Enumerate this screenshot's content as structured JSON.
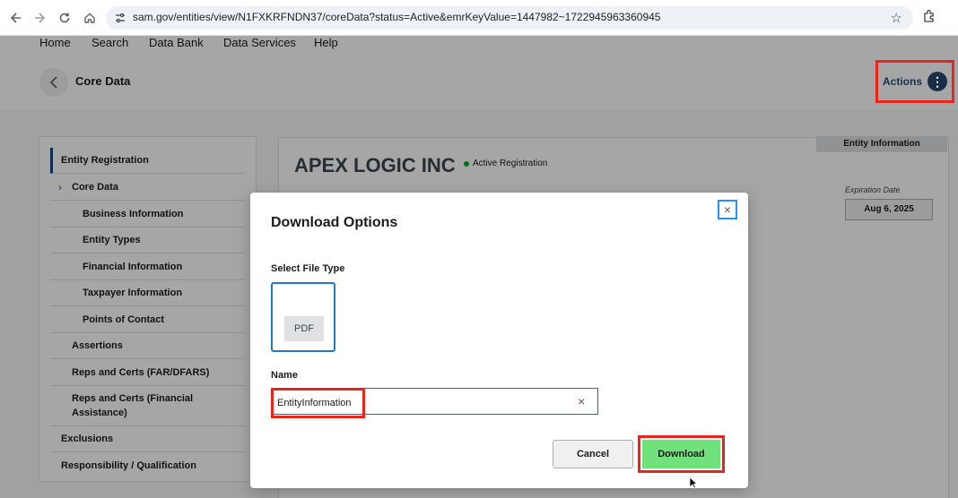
{
  "browser": {
    "url": "sam.gov/entities/view/N1FXKRFNDN37/coreData?status=Active&emrKeyValue=1447982~1722945963360945"
  },
  "topnav": [
    "Home",
    "Search",
    "Data Bank",
    "Data Services",
    "Help"
  ],
  "subheader": {
    "title": "Core Data",
    "actions_label": "Actions"
  },
  "sidenav": {
    "items": [
      {
        "label": "Entity Registration"
      },
      {
        "label": "Core Data"
      },
      {
        "label": "Business Information"
      },
      {
        "label": "Entity Types"
      },
      {
        "label": "Financial Information"
      },
      {
        "label": "Taxpayer Information"
      },
      {
        "label": "Points of Contact"
      },
      {
        "label": "Assertions"
      },
      {
        "label": "Reps and Certs (FAR/DFARS)"
      },
      {
        "label": "Reps and Certs (Financial Assistance)"
      },
      {
        "label": "Exclusions"
      },
      {
        "label": "Responsibility / Qualification"
      }
    ]
  },
  "entity": {
    "tab_label": "Entity Information",
    "name": "APEX LOGIC INC",
    "status": "Active Registration",
    "expiration_label": "Expiration Date",
    "expiration_value": "Aug 6, 2025"
  },
  "modal": {
    "title": "Download Options",
    "close_symbol": "×",
    "file_type_label": "Select File Type",
    "file_type_option": "PDF",
    "name_label": "Name",
    "name_value": "EntityInformation",
    "clear_symbol": "×",
    "cancel_label": "Cancel",
    "download_label": "Download"
  },
  "colors": {
    "highlight": "#e8251b",
    "download_button": "#70e17b",
    "focus_blue": "#2491ff",
    "active_green": "#00a91c"
  }
}
